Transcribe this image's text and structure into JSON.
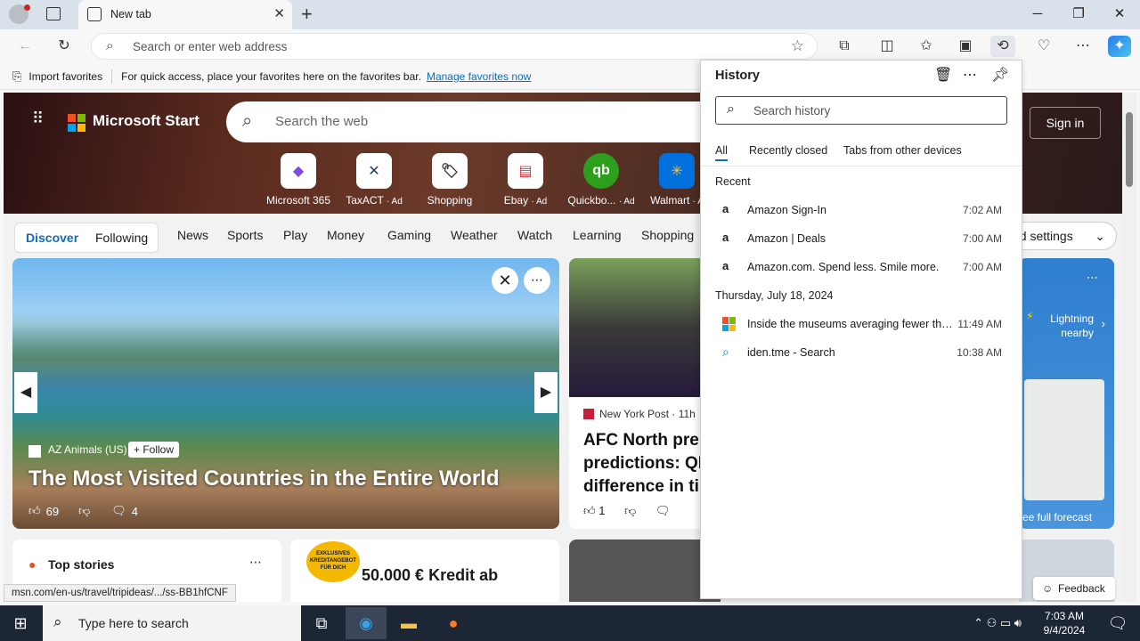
{
  "browser": {
    "tab_title": "New tab",
    "address_placeholder": "Search or enter web address",
    "favbar_import": "Import favorites",
    "favbar_message": "For quick access, place your favorites here on the favorites bar.",
    "favbar_link": "Manage favorites now"
  },
  "page": {
    "brand": "Microsoft Start",
    "search_placeholder": "Search the web",
    "signin": "Sign in",
    "tiles": [
      {
        "label": "Microsoft 365",
        "ad": ""
      },
      {
        "label": "TaxACT",
        "ad": "· Ad"
      },
      {
        "label": "Shopping",
        "ad": ""
      },
      {
        "label": "Ebay",
        "ad": "· Ad"
      },
      {
        "label": "Quickbo...",
        "ad": "· Ad"
      },
      {
        "label": "Walmart",
        "ad": "· A"
      }
    ],
    "nav": {
      "discover": "Discover",
      "following": "Following",
      "items": [
        "News",
        "Sports",
        "Play",
        "Money",
        "Gaming",
        "Weather",
        "Watch",
        "Learning",
        "Shopping"
      ],
      "settings": "ed settings"
    },
    "main_story": {
      "source": "AZ Animals (US)",
      "follow": "+ Follow",
      "title": "The Most Visited Countries in the Entire World",
      "likes": "69",
      "comments": "4"
    },
    "second_story": {
      "source": "New York Post · 11h",
      "title": "AFC North pre predictions: QI difference in ti",
      "likes": "1"
    },
    "top_stories": "Top stories",
    "ad_badge": "EXKLUSIVES KREDITANGEBOT FÜR DICH",
    "ad_text": "50.000 € Kredit ab",
    "weather": {
      "alert": "Lightning nearby",
      "forecast_link": "ee full forecast"
    },
    "status_url": "msn.com/en-us/travel/tripideas/.../ss-BB1hfCNF",
    "feedback": "Feedback"
  },
  "history": {
    "title": "History",
    "search_placeholder": "Search history",
    "tabs": [
      "All",
      "Recently closed",
      "Tabs from other devices"
    ],
    "sections": [
      {
        "label": "Recent",
        "items": [
          {
            "icon": "amazon-icon",
            "title": "Amazon Sign-In",
            "time": "7:02 AM"
          },
          {
            "icon": "amazon-icon",
            "title": "Amazon | Deals",
            "time": "7:00 AM"
          },
          {
            "icon": "amazon-icon",
            "title": "Amazon.com. Spend less. Smile more.",
            "time": "7:00 AM"
          }
        ]
      },
      {
        "label": "Thursday, July 18, 2024",
        "items": [
          {
            "icon": "microsoft-icon",
            "title": "Inside the museums averaging fewer than ...",
            "time": "11:49 AM"
          },
          {
            "icon": "search-icon",
            "title": "iden.tme - Search",
            "time": "10:38 AM"
          }
        ]
      }
    ]
  },
  "taskbar": {
    "search_placeholder": "Type here to search",
    "time": "7:03 AM",
    "date": "9/4/2024"
  },
  "colors": {
    "accent": "#0f6cbd",
    "taskbar": "#1c2634",
    "tabstrip": "#d9e1ea"
  }
}
